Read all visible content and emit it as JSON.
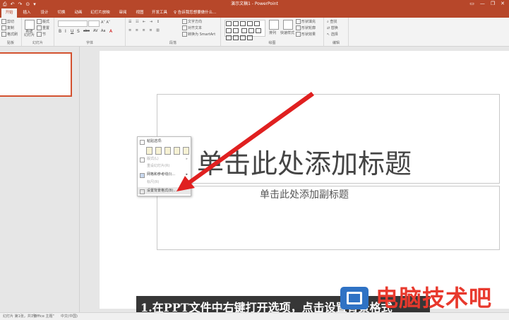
{
  "window": {
    "title": "演示文稿1 - PowerPoint",
    "quick_access": [
      "⎙",
      "↶",
      "↷",
      "⊙",
      "▾"
    ],
    "controls": [
      "▭",
      "—",
      "❐",
      "✕"
    ]
  },
  "ribbon_tabs": [
    {
      "label": "开始",
      "active": true
    },
    {
      "label": "插入",
      "active": false
    },
    {
      "label": "设计",
      "active": false
    },
    {
      "label": "切换",
      "active": false
    },
    {
      "label": "动画",
      "active": false
    },
    {
      "label": "幻灯片放映",
      "active": false
    },
    {
      "label": "审阅",
      "active": false
    },
    {
      "label": "视图",
      "active": false
    },
    {
      "label": "开发工具",
      "active": false
    }
  ],
  "tell_me": "告诉我您想要做什么...",
  "ribbon": {
    "clipboard": {
      "cut": "剪切",
      "copy": "复制",
      "format_painter": "格式刷",
      "label": "贴板"
    },
    "slides": {
      "new_slide": "新建\n幻灯片",
      "layout": "版式",
      "reset": "重置",
      "section": "节",
      "label": "幻灯片"
    },
    "font": {
      "label": "字体",
      "format_buttons": [
        "B",
        "I",
        "U",
        "S",
        "abc",
        "AV",
        "Aa",
        "A"
      ]
    },
    "paragraph": {
      "text_direction": "文字方向",
      "align_text": "对齐文本",
      "smartart": "转换为 SmartArt",
      "label": "段落"
    },
    "drawing": {
      "arrange": "排列",
      "quick_styles": "快速样式",
      "shape_fill": "形状填充",
      "shape_outline": "形状轮廓",
      "shape_effects": "形状效果",
      "label": "绘图"
    },
    "editing": {
      "find": "查找",
      "replace": "替换",
      "select": "选择",
      "label": "编辑"
    }
  },
  "slide": {
    "title_placeholder": "单击此处添加标题",
    "subtitle_placeholder": "单击此处添加副标题"
  },
  "context_menu": {
    "items": [
      {
        "label": "粘贴选项:",
        "disabled": false
      },
      {
        "label": "版式(L)",
        "disabled": true,
        "submenu": true
      },
      {
        "label": "重设幻灯片(R)",
        "disabled": true
      },
      {
        "label": "网格和参考线(I)...",
        "disabled": false,
        "submenu": true
      },
      {
        "label": "标尺(R)",
        "disabled": true
      },
      {
        "label": "设置背景格式(B)...",
        "disabled": false,
        "highlighted": true
      }
    ]
  },
  "caption": "1.在PPT文件中右键打开选项，点击设置背景格式",
  "watermark": "电脑技术吧",
  "status_bar": {
    "slide_info": "幻灯片 第1张，共1张",
    "theme": "\"Office 主题\"",
    "language": "中文(中国)"
  },
  "colors": {
    "accent": "#b7472a",
    "arrow": "#e02020",
    "watermark": "#e8392d",
    "logo": "#2f72c4"
  }
}
